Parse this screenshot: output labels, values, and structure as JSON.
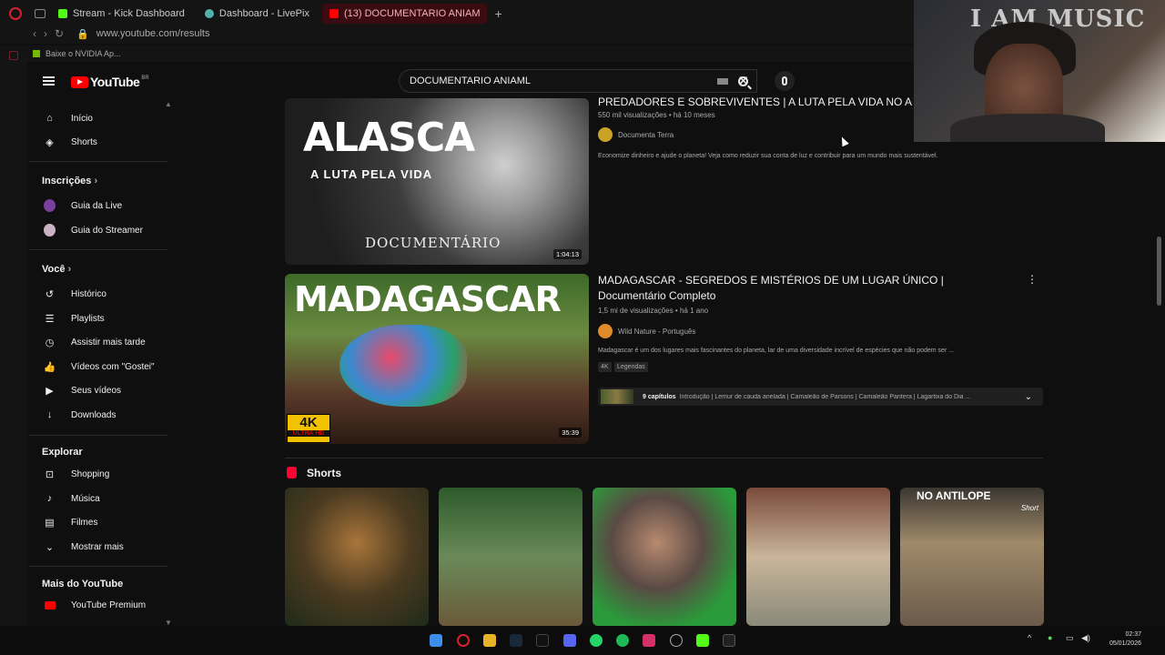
{
  "browser": {
    "tabs": [
      {
        "label": "Stream - Kick Dashboard",
        "color": "#53fc18"
      },
      {
        "label": "Dashboard - LivePix",
        "color": "#4fb3a9"
      },
      {
        "label": "(13) DOCUMENTARIO ANIAM",
        "color": "#ff0000",
        "active": true
      }
    ],
    "url": "www.youtube.com/results",
    "bookmark": "Baixe o NVIDIA Ap..."
  },
  "masthead": {
    "logo": "YouTube",
    "country": "BR",
    "search_value": "DOCUMENTARIO ANIAML"
  },
  "sidebar": {
    "main": [
      {
        "label": "Início",
        "icon": "home-icon"
      },
      {
        "label": "Shorts",
        "icon": "shorts-icon"
      }
    ],
    "subscriptions_header": "Inscrições",
    "subscriptions": [
      {
        "label": "Guia da Live",
        "color": "#7b3fa0"
      },
      {
        "label": "Guia do Streamer",
        "color": "#c9b2c4"
      }
    ],
    "you_header": "Você",
    "you": [
      {
        "label": "Histórico",
        "icon": "history-icon"
      },
      {
        "label": "Playlists",
        "icon": "playlist-icon"
      },
      {
        "label": "Assistir mais tarde",
        "icon": "clock-icon"
      },
      {
        "label": "Vídeos com \"Gostei\"",
        "icon": "like-icon"
      },
      {
        "label": "Seus vídeos",
        "icon": "video-icon"
      },
      {
        "label": "Downloads",
        "icon": "download-icon"
      }
    ],
    "explore_header": "Explorar",
    "explore": [
      {
        "label": "Shopping",
        "icon": "shopping-icon"
      },
      {
        "label": "Música",
        "icon": "music-icon"
      },
      {
        "label": "Filmes",
        "icon": "film-icon"
      },
      {
        "label": "Mostrar mais",
        "icon": "chevron-down-icon"
      }
    ],
    "more_header": "Mais do YouTube",
    "more": [
      {
        "label": "YouTube Premium",
        "icon": "youtube-premium-icon"
      }
    ]
  },
  "results": [
    {
      "title": "PREDADORES E SOBREVIVENTES | A LUTA PELA VIDA NO ALASCA",
      "meta": "550 mil visualizações • há 10 meses",
      "channel": "Documenta Terra",
      "channel_color": "#c9a227",
      "description": "Economize dinheiro e ajude o planeta! Veja como reduzir sua conta de luz e contribuir para um mundo mais sustentável.",
      "thumb_title": "ALASCA",
      "thumb_subtitle": "A LUTA PELA VIDA",
      "thumb_footer": "DOCUMENTÁRIO",
      "duration": "1:04:13"
    },
    {
      "title": "MADAGASCAR - SEGREDOS E MISTÉRIOS DE UM LUGAR ÚNICO | Documentário Completo",
      "meta": "1,5 mi de visualizações • há 1 ano",
      "channel": "Wild Nature - Português",
      "channel_color": "#e08a2a",
      "description": "Madagascar é um dos lugares mais fascinantes do planeta, lar de uma diversidade incrível de espécies que não podem ser ...",
      "badges": [
        "4K",
        "Legendas"
      ],
      "chapters_count": "9 capítulos",
      "chapters": "Introdução | Lemur de cauda anelada | Camaleão de Parsons | Camaleão Pantera | Lagartixa do Dia ...",
      "thumb_title": "MADAGASCAR",
      "thumb_badge": "4K",
      "thumb_badge_sub": "ULTRA HD",
      "duration": "35:39"
    }
  ],
  "shorts": {
    "title": "Shorts",
    "items": [
      {
        "overlay": ""
      },
      {
        "overlay": ""
      },
      {
        "overlay": ""
      },
      {
        "overlay": ""
      },
      {
        "overlay": "NO ANTILOPE",
        "tag": "Short"
      }
    ]
  },
  "webcam": {
    "banner": "I AM MUSIC"
  },
  "clock": {
    "time": "02:37",
    "date": "05/01/2026"
  },
  "colors": {
    "accent": "#ff0000",
    "bg": "#0f0f0f"
  }
}
